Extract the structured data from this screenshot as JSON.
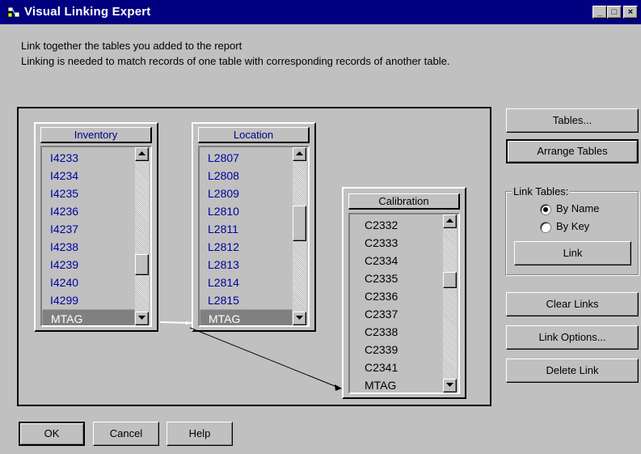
{
  "window": {
    "title": "Visual Linking Expert",
    "minimize_label": "_",
    "maximize_label": "□",
    "close_label": "×"
  },
  "description": {
    "line1": "Link together the tables you added to the report",
    "line2": "Linking is needed to match records of one table with corresponding records of another table."
  },
  "tables": {
    "inventory": {
      "name": "Inventory",
      "fields": [
        "I4233",
        "I4234",
        "I4235",
        "I4236",
        "I4237",
        "I4238",
        "I4239",
        "I4240",
        "I4299",
        "MTAG"
      ],
      "selected": "MTAG"
    },
    "location": {
      "name": "Location",
      "fields": [
        "L2807",
        "L2808",
        "L2809",
        "L2810",
        "L2811",
        "L2812",
        "L2813",
        "L2814",
        "L2815",
        "MTAG"
      ],
      "selected": "MTAG"
    },
    "calibration": {
      "name": "Calibration",
      "fields": [
        "C2332",
        "C2333",
        "C2334",
        "C2335",
        "C2336",
        "C2337",
        "C2338",
        "C2339",
        "C2341",
        "MTAG"
      ]
    }
  },
  "links": [
    {
      "from": "Inventory.MTAG",
      "to": "Location.MTAG"
    },
    {
      "from": "Location.MTAG",
      "to": "Calibration.MTAG"
    }
  ],
  "side_buttons": {
    "tables": "Tables...",
    "arrange": "Arrange Tables",
    "link": "Link",
    "clear_links": "Clear Links",
    "link_options": "Link Options...",
    "delete_link": "Delete Link"
  },
  "link_tables": {
    "label": "Link Tables:",
    "by_name": "By Name",
    "by_key": "By Key",
    "selected": "By Name"
  },
  "bottom_buttons": {
    "ok": "OK",
    "cancel": "Cancel",
    "help": "Help"
  },
  "colors": {
    "title_bar": "#000080",
    "field_text": "#0000a0",
    "face": "#c0c0c0"
  }
}
